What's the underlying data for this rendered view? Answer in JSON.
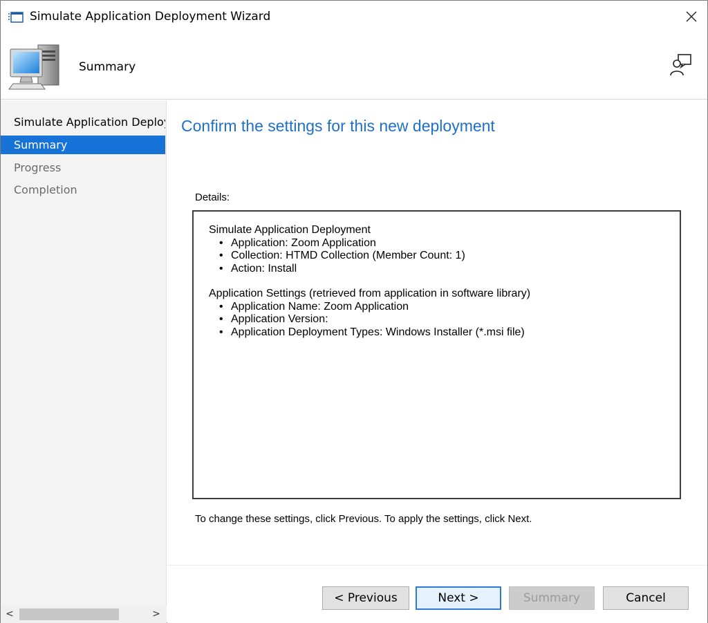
{
  "window": {
    "title": "Simulate Application Deployment Wizard",
    "close_glyph": "✕"
  },
  "header": {
    "title": "Summary",
    "icon": "computer-icon",
    "help_icon": "feedback-icon"
  },
  "nav": {
    "items": [
      {
        "label": "Simulate Application Deployment",
        "state": "completed"
      },
      {
        "label": "Summary",
        "state": "current"
      },
      {
        "label": "Progress",
        "state": "future"
      },
      {
        "label": "Completion",
        "state": "future"
      }
    ],
    "scroll_left": "<",
    "scroll_right": ">"
  },
  "main": {
    "heading": "Confirm the settings for this new deployment",
    "details_label": "Details:",
    "sections": [
      {
        "title": "Simulate Application Deployment",
        "bullets": [
          "Application: Zoom Application",
          "Collection: HTMD Collection (Member Count: 1)",
          "Action: Install"
        ]
      },
      {
        "title": "Application Settings (retrieved from application in software library)",
        "bullets": [
          "Application Name: Zoom Application",
          "Application Version:",
          "Application Deployment Types: Windows Installer (*.msi file)"
        ]
      }
    ],
    "hint": "To change these settings, click Previous. To apply the settings, click Next."
  },
  "buttons": {
    "previous": "< Previous",
    "next": "Next >",
    "summary": "Summary",
    "cancel": "Cancel"
  },
  "colors": {
    "accent": "#1773d7",
    "heading": "#1f6fc8"
  }
}
